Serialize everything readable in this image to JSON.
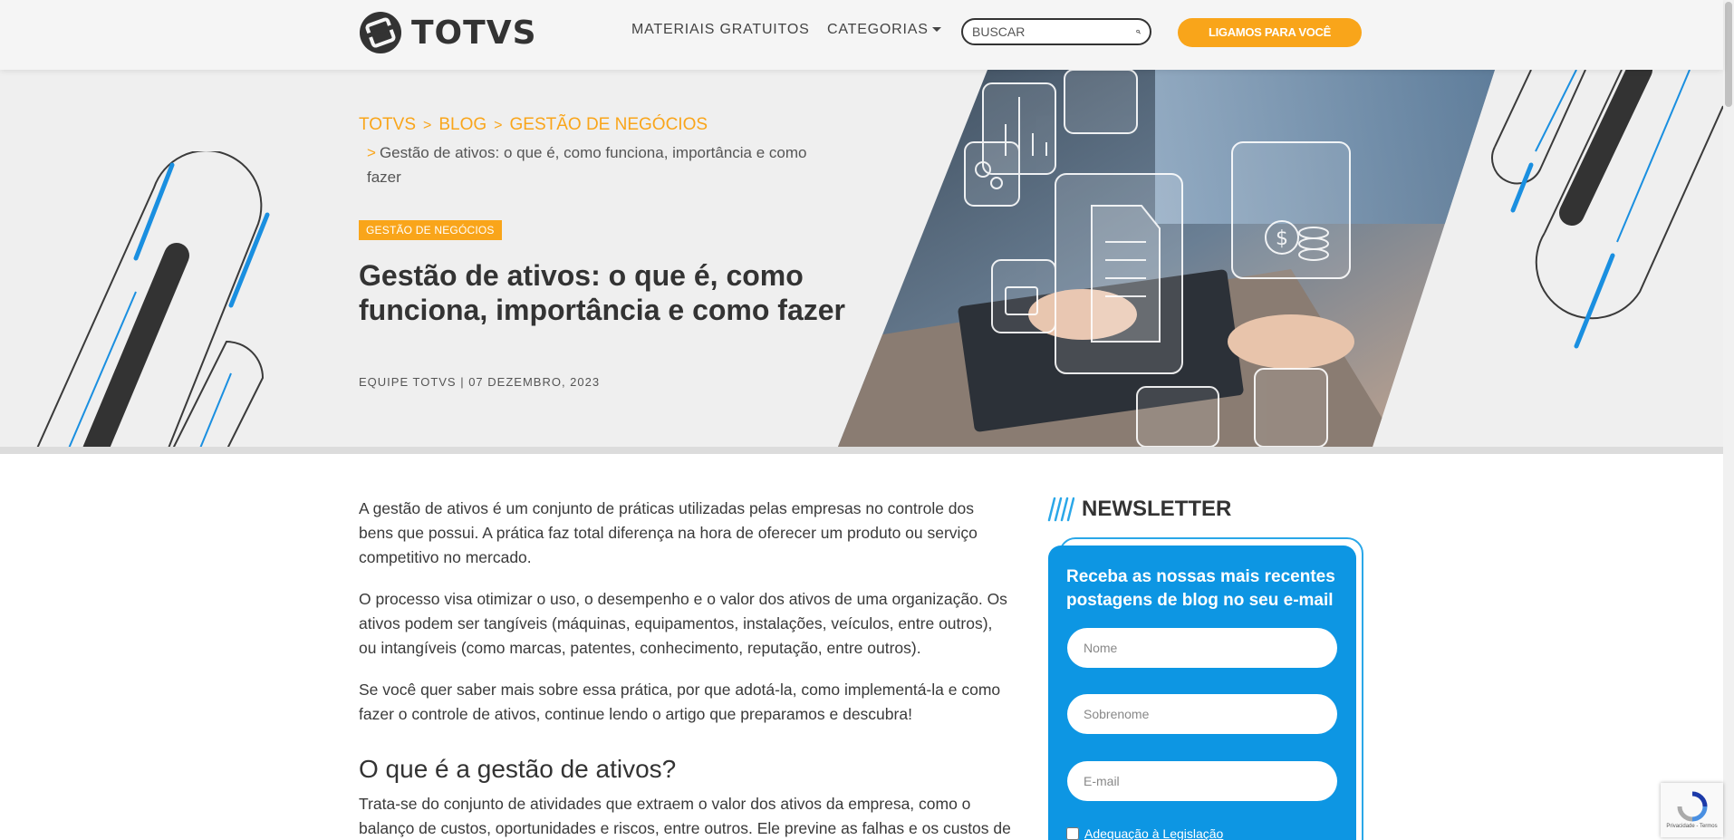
{
  "header": {
    "logo_text": "TOTVS",
    "nav_materiais": "MATERIAIS GRATUITOS",
    "nav_categorias": "CATEGORIAS",
    "search_placeholder": "BUSCAR",
    "cta_label": "LIGAMOS PARA VOCÊ"
  },
  "breadcrumb": {
    "items": [
      "TOTVS",
      "BLOG",
      "GESTÃO DE NEGÓCIOS"
    ],
    "separator": ">",
    "current": "Gestão de ativos: o que é, como funciona, importância e como fazer"
  },
  "hero": {
    "tag": "GESTÃO DE NEGÓCIOS",
    "title": "Gestão de ativos: o que é, como funciona, importância e como fazer",
    "meta": "EQUIPE TOTVS | 07 DEZEMBRO, 2023"
  },
  "article": {
    "paragraphs": [
      "A gestão de ativos é um conjunto de práticas utilizadas pelas empresas no controle dos bens que possui. A prática faz total diferença na hora de oferecer um produto ou serviço competitivo no mercado.",
      "O processo visa otimizar o uso, o desempenho e o valor dos ativos de uma organização. Os ativos podem ser tangíveis (máquinas, equipamentos, instalações, veículos, entre outros), ou intangíveis (como marcas, patentes, conhecimento, reputação, entre outros).",
      "Se você quer saber mais sobre essa prática, por que adotá-la, como implementá-la e como fazer o controle de ativos, continue lendo o artigo que preparamos e descubra!"
    ],
    "h2": "O que é a gestão de ativos?",
    "p4": "Trata-se do conjunto de atividades que extraem o valor dos ativos da empresa, como o balanço de custos, oportunidades e riscos, entre outros. Ele previne as falhas e os custos de"
  },
  "newsletter": {
    "title": "NEWSLETTER",
    "description": "Receba as nossas mais recentes postagens de blog no seu e-mail",
    "name_placeholder": "Nome",
    "surname_placeholder": "Sobrenome",
    "email_placeholder": "E-mail",
    "checkbox_label": "Adequação à Legislação"
  },
  "recaptcha": {
    "text": "Privacidade - Termos"
  },
  "colors": {
    "accent": "#f9a51a",
    "newsletter_blue": "#0d96e3",
    "dark": "#333333"
  }
}
